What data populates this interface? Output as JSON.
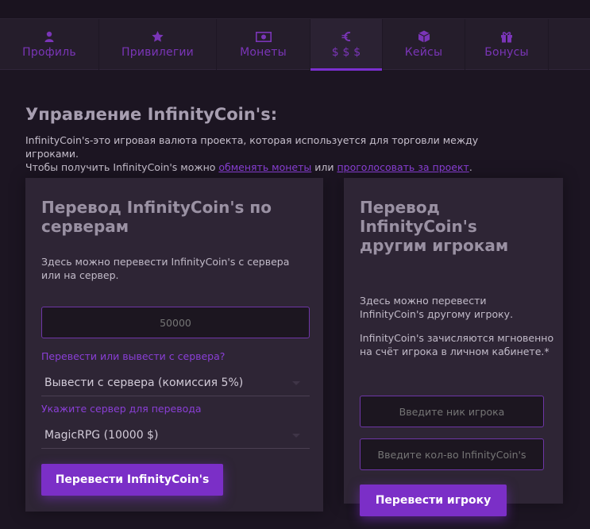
{
  "tabs": [
    {
      "label": "Профиль",
      "icon": "user-icon"
    },
    {
      "label": "Привилегии",
      "icon": "star-icon"
    },
    {
      "label": "Монеты",
      "icon": "banknote-icon"
    },
    {
      "label": "$ $ $",
      "icon": "euro-icon",
      "active": true
    },
    {
      "label": "Кейсы",
      "icon": "box-icon"
    },
    {
      "label": "Бонусы",
      "icon": "gift-icon"
    }
  ],
  "page": {
    "title": "Управление InfinityCoin's:",
    "intro_line1": "InfinityCoin's-это игровая валюта проекта, которая используется для торговли между игроками.",
    "intro_line2_prefix": "Чтобы получить InfinityCoin's можно ",
    "intro_link1": "обменять монеты",
    "intro_mid": " или ",
    "intro_link2": "проголосовать за проект",
    "intro_end": "."
  },
  "server_transfer": {
    "title": "Перевод InfinityCoin's по серверам",
    "description": "Здесь можно перевести InfinityCoin's с сервера или на сервер.",
    "amount_placeholder": "50000",
    "direction_label": "Перевести или вывести с сервера?",
    "direction_value": "Вывести с сервера (комиссия 5%)",
    "server_label": "Укажите сервер для перевода",
    "server_value": "MagicRPG (10000 $)",
    "submit_label": "Перевести InfinityCoin's"
  },
  "player_transfer": {
    "title": "Перевод InfinityCoin's другим игрокам",
    "description1": "Здесь можно перевести InfinityCoin's другому игроку.",
    "description2": "InfinityCoin's зачисляются мгновенно на счёт игрока в личном кабинете.*",
    "nick_placeholder": "Введите ник игрока",
    "amount_placeholder": "Введите кол-во InfinityCoin's",
    "submit_label": "Перевести игроку"
  },
  "colors": {
    "accent": "#7b2fc7",
    "link": "#8a3fd6",
    "background": "#1c1522",
    "card": "#2e2535"
  }
}
